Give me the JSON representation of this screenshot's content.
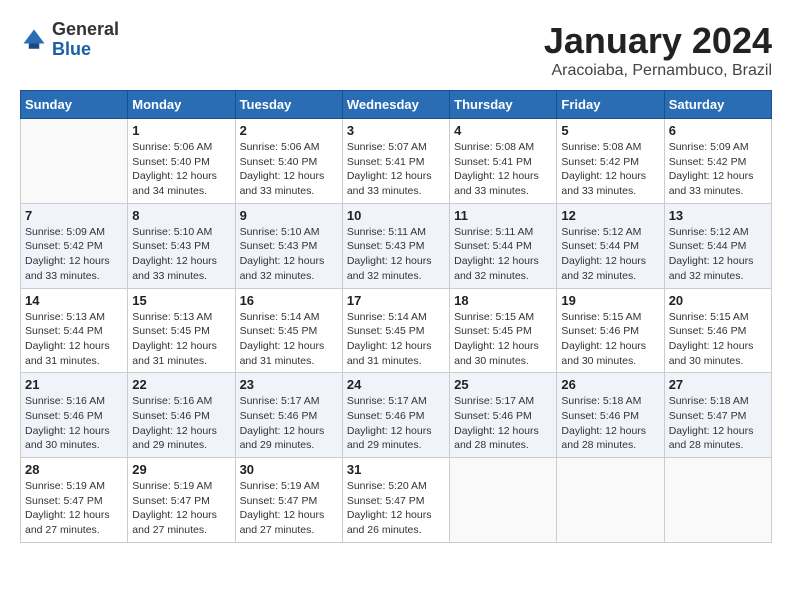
{
  "header": {
    "logo_line1": "General",
    "logo_line2": "Blue",
    "month": "January 2024",
    "location": "Aracoiaba, Pernambuco, Brazil"
  },
  "days_of_week": [
    "Sunday",
    "Monday",
    "Tuesday",
    "Wednesday",
    "Thursday",
    "Friday",
    "Saturday"
  ],
  "weeks": [
    [
      {
        "day": "",
        "info": ""
      },
      {
        "day": "1",
        "info": "Sunrise: 5:06 AM\nSunset: 5:40 PM\nDaylight: 12 hours\nand 34 minutes."
      },
      {
        "day": "2",
        "info": "Sunrise: 5:06 AM\nSunset: 5:40 PM\nDaylight: 12 hours\nand 33 minutes."
      },
      {
        "day": "3",
        "info": "Sunrise: 5:07 AM\nSunset: 5:41 PM\nDaylight: 12 hours\nand 33 minutes."
      },
      {
        "day": "4",
        "info": "Sunrise: 5:08 AM\nSunset: 5:41 PM\nDaylight: 12 hours\nand 33 minutes."
      },
      {
        "day": "5",
        "info": "Sunrise: 5:08 AM\nSunset: 5:42 PM\nDaylight: 12 hours\nand 33 minutes."
      },
      {
        "day": "6",
        "info": "Sunrise: 5:09 AM\nSunset: 5:42 PM\nDaylight: 12 hours\nand 33 minutes."
      }
    ],
    [
      {
        "day": "7",
        "info": "Sunrise: 5:09 AM\nSunset: 5:42 PM\nDaylight: 12 hours\nand 33 minutes."
      },
      {
        "day": "8",
        "info": "Sunrise: 5:10 AM\nSunset: 5:43 PM\nDaylight: 12 hours\nand 33 minutes."
      },
      {
        "day": "9",
        "info": "Sunrise: 5:10 AM\nSunset: 5:43 PM\nDaylight: 12 hours\nand 32 minutes."
      },
      {
        "day": "10",
        "info": "Sunrise: 5:11 AM\nSunset: 5:43 PM\nDaylight: 12 hours\nand 32 minutes."
      },
      {
        "day": "11",
        "info": "Sunrise: 5:11 AM\nSunset: 5:44 PM\nDaylight: 12 hours\nand 32 minutes."
      },
      {
        "day": "12",
        "info": "Sunrise: 5:12 AM\nSunset: 5:44 PM\nDaylight: 12 hours\nand 32 minutes."
      },
      {
        "day": "13",
        "info": "Sunrise: 5:12 AM\nSunset: 5:44 PM\nDaylight: 12 hours\nand 32 minutes."
      }
    ],
    [
      {
        "day": "14",
        "info": "Sunrise: 5:13 AM\nSunset: 5:44 PM\nDaylight: 12 hours\nand 31 minutes."
      },
      {
        "day": "15",
        "info": "Sunrise: 5:13 AM\nSunset: 5:45 PM\nDaylight: 12 hours\nand 31 minutes."
      },
      {
        "day": "16",
        "info": "Sunrise: 5:14 AM\nSunset: 5:45 PM\nDaylight: 12 hours\nand 31 minutes."
      },
      {
        "day": "17",
        "info": "Sunrise: 5:14 AM\nSunset: 5:45 PM\nDaylight: 12 hours\nand 31 minutes."
      },
      {
        "day": "18",
        "info": "Sunrise: 5:15 AM\nSunset: 5:45 PM\nDaylight: 12 hours\nand 30 minutes."
      },
      {
        "day": "19",
        "info": "Sunrise: 5:15 AM\nSunset: 5:46 PM\nDaylight: 12 hours\nand 30 minutes."
      },
      {
        "day": "20",
        "info": "Sunrise: 5:15 AM\nSunset: 5:46 PM\nDaylight: 12 hours\nand 30 minutes."
      }
    ],
    [
      {
        "day": "21",
        "info": "Sunrise: 5:16 AM\nSunset: 5:46 PM\nDaylight: 12 hours\nand 30 minutes."
      },
      {
        "day": "22",
        "info": "Sunrise: 5:16 AM\nSunset: 5:46 PM\nDaylight: 12 hours\nand 29 minutes."
      },
      {
        "day": "23",
        "info": "Sunrise: 5:17 AM\nSunset: 5:46 PM\nDaylight: 12 hours\nand 29 minutes."
      },
      {
        "day": "24",
        "info": "Sunrise: 5:17 AM\nSunset: 5:46 PM\nDaylight: 12 hours\nand 29 minutes."
      },
      {
        "day": "25",
        "info": "Sunrise: 5:17 AM\nSunset: 5:46 PM\nDaylight: 12 hours\nand 28 minutes."
      },
      {
        "day": "26",
        "info": "Sunrise: 5:18 AM\nSunset: 5:46 PM\nDaylight: 12 hours\nand 28 minutes."
      },
      {
        "day": "27",
        "info": "Sunrise: 5:18 AM\nSunset: 5:47 PM\nDaylight: 12 hours\nand 28 minutes."
      }
    ],
    [
      {
        "day": "28",
        "info": "Sunrise: 5:19 AM\nSunset: 5:47 PM\nDaylight: 12 hours\nand 27 minutes."
      },
      {
        "day": "29",
        "info": "Sunrise: 5:19 AM\nSunset: 5:47 PM\nDaylight: 12 hours\nand 27 minutes."
      },
      {
        "day": "30",
        "info": "Sunrise: 5:19 AM\nSunset: 5:47 PM\nDaylight: 12 hours\nand 27 minutes."
      },
      {
        "day": "31",
        "info": "Sunrise: 5:20 AM\nSunset: 5:47 PM\nDaylight: 12 hours\nand 26 minutes."
      },
      {
        "day": "",
        "info": ""
      },
      {
        "day": "",
        "info": ""
      },
      {
        "day": "",
        "info": ""
      }
    ]
  ]
}
